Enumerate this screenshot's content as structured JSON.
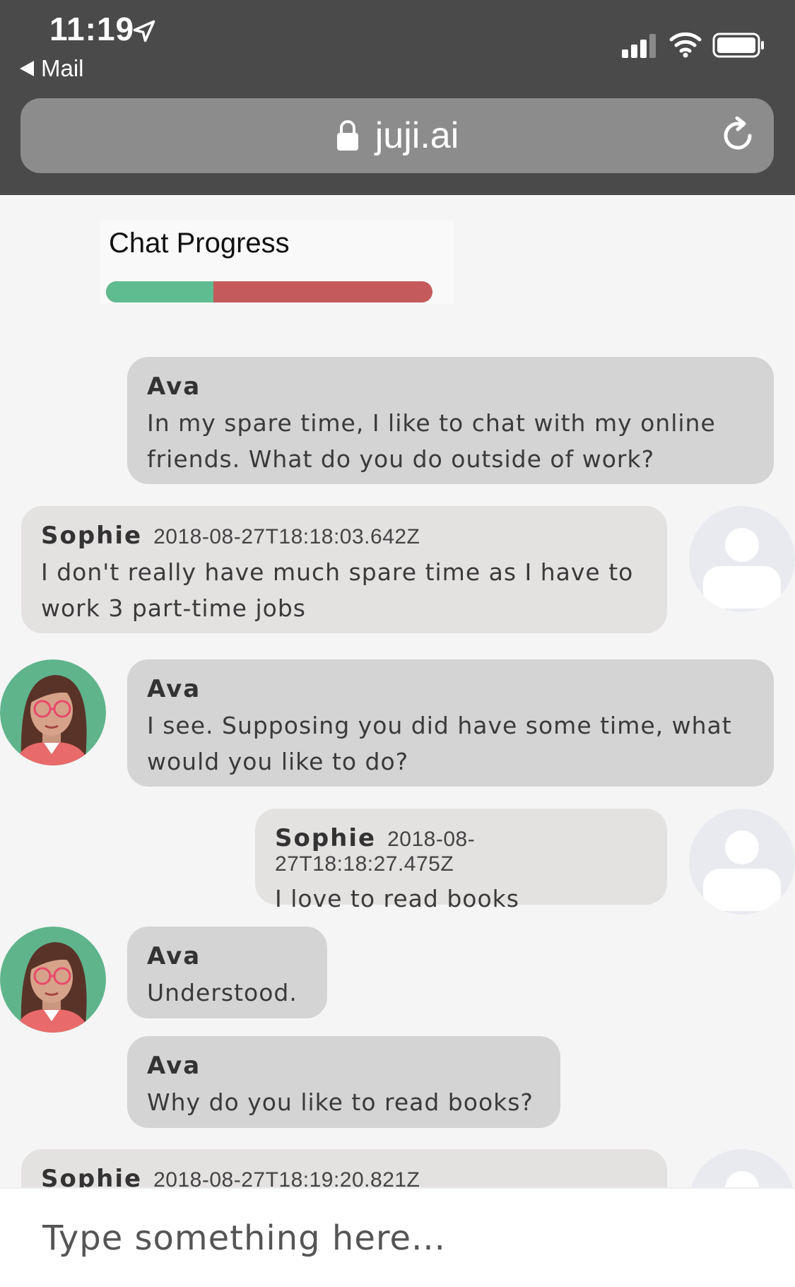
{
  "status_bar": {
    "time": "11:19",
    "back_label": "Mail"
  },
  "browser": {
    "url": "juji.ai"
  },
  "progress": {
    "title": "Chat Progress",
    "fraction": 0.33,
    "fill_color": "#5fbb90",
    "remaining_color": "#c45a5c"
  },
  "messages": [
    {
      "sender": "Ava",
      "lines": [
        "In my spare time, I like to chat with my online",
        "friends. What do you do outside of work?"
      ]
    },
    {
      "sender": "Sophie",
      "timestamp": "2018-08-27T18:18:03.642Z",
      "lines": [
        "I don't really have much spare time as I have to",
        "work 3 part-time jobs"
      ]
    },
    {
      "sender": "Ava",
      "lines": [
        "I see. Supposing you did have some time, what",
        "would you like to do?"
      ]
    },
    {
      "sender": "Sophie",
      "timestamp": "2018-08-27T18:18:27.475Z",
      "lines": [
        "I love to read books"
      ]
    },
    {
      "sender": "Ava",
      "lines": [
        "Understood."
      ]
    },
    {
      "sender": "Ava",
      "lines": [
        "Why do you like to read books?"
      ]
    },
    {
      "sender": "Sophie",
      "timestamp": "2018-08-27T18:19:20.821Z",
      "lines": []
    }
  ],
  "input": {
    "placeholder": "Type something here..."
  }
}
